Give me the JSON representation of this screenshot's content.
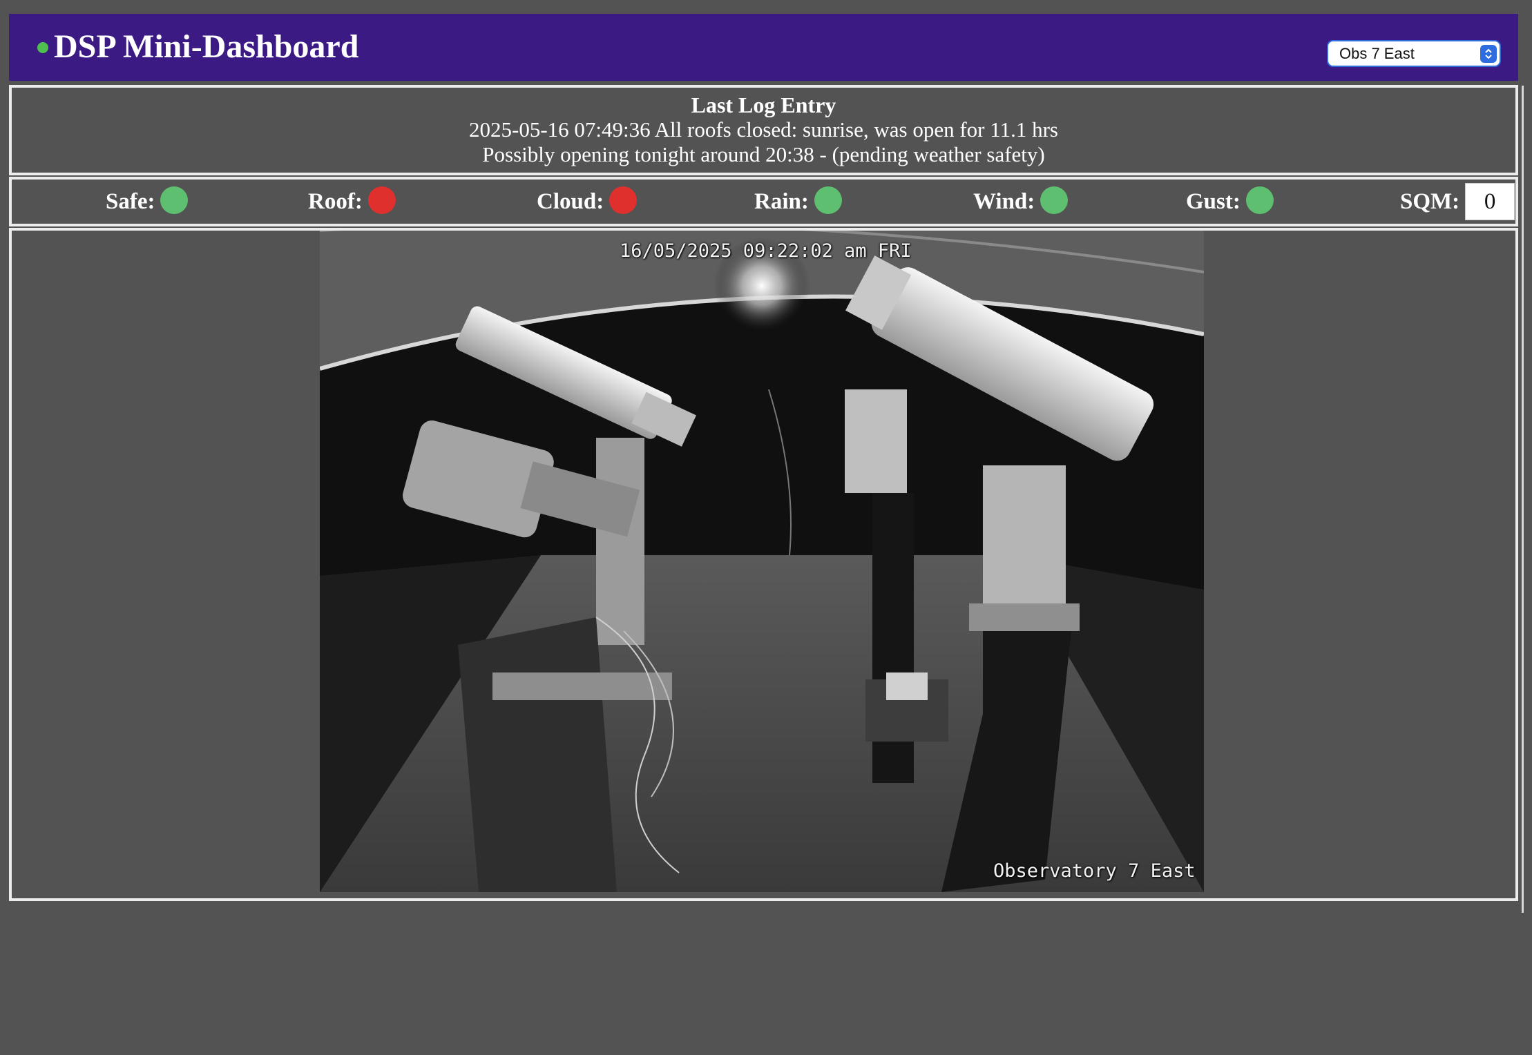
{
  "header": {
    "title": "DSP Mini-Dashboard",
    "status_color": "#4fc04f",
    "observatory_select": {
      "value": "Obs 7 East"
    }
  },
  "log": {
    "heading": "Last Log Entry",
    "line1": "2025-05-16 07:49:36 All roofs closed: sunrise, was open for 11.1 hrs",
    "line2": "Possibly opening tonight around 20:38 - (pending weather safety)"
  },
  "status": {
    "safe": {
      "label": "Safe:",
      "state": "green"
    },
    "roof": {
      "label": "Roof:",
      "state": "red"
    },
    "cloud": {
      "label": "Cloud:",
      "state": "red"
    },
    "rain": {
      "label": "Rain:",
      "state": "green"
    },
    "wind": {
      "label": "Wind:",
      "state": "green"
    },
    "gust": {
      "label": "Gust:",
      "state": "green"
    },
    "sqm": {
      "label": "SQM:",
      "value": "0"
    },
    "colors": {
      "green": "#5fbf70",
      "red": "#e0302d"
    }
  },
  "camera": {
    "timestamp": "16/05/2025 09:22:02 am FRI",
    "label": "Observatory 7 East"
  }
}
